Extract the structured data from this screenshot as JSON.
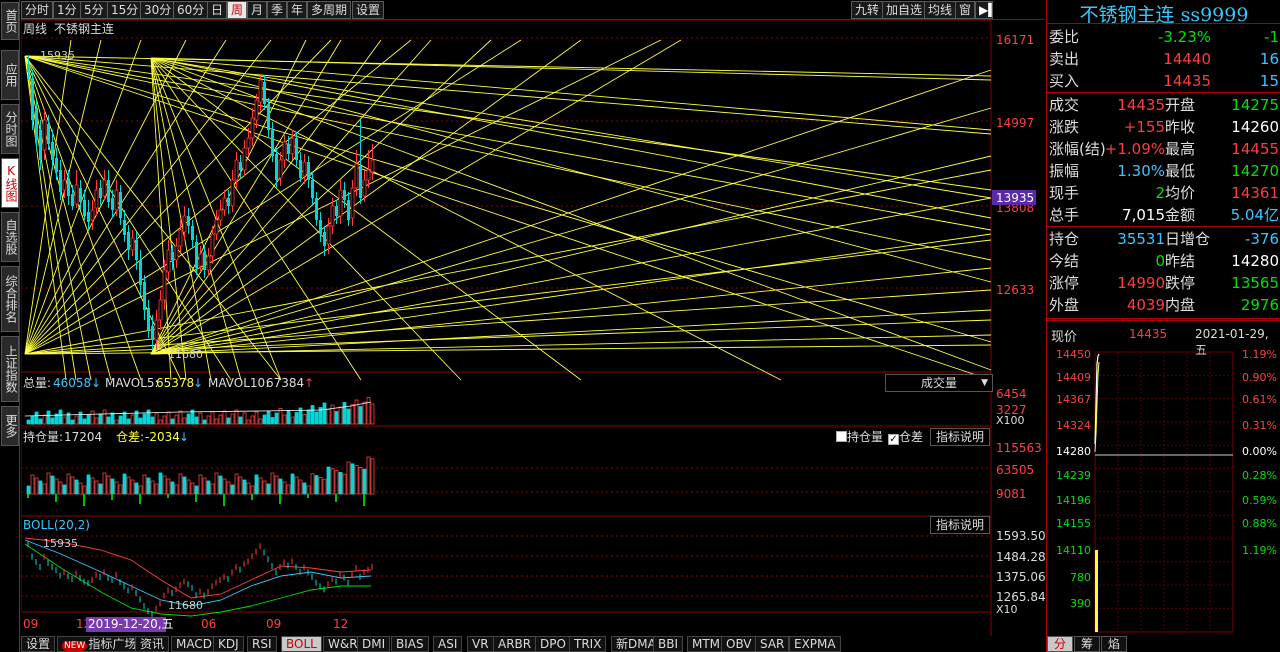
{
  "sidebar": {
    "items": [
      {
        "label": "首页",
        "active": false
      },
      {
        "label": "应用",
        "active": false
      },
      {
        "label": "分时图",
        "active": false
      },
      {
        "label": "K线图",
        "active": true
      },
      {
        "label": "自选股",
        "active": false
      },
      {
        "label": "综合排名",
        "active": false
      },
      {
        "label": "上证指数",
        "active": false
      },
      {
        "label": "更多",
        "active": false
      }
    ]
  },
  "periods": [
    "分时",
    "1分",
    "5分",
    "15分",
    "30分",
    "60分",
    "日",
    "周",
    "月",
    "季",
    "年",
    "多周期",
    "设置"
  ],
  "active_period": "周",
  "toolbar_right": [
    "九转",
    "加自选",
    "均线",
    "窗"
  ],
  "chart": {
    "period_label": "周线",
    "instrument": "不锈钢主连",
    "price_axis": [
      "16171",
      "14997",
      "13935",
      "13808",
      "12633"
    ],
    "current_price_tag": "13935",
    "high_label": "15935",
    "low_label": "11680",
    "volume": {
      "label": "总量:",
      "total": "46058",
      "mavol5_label": "MAVOL5:",
      "mavol5": "65378",
      "mavol10_label": "MAVOL10:",
      "mavol10": "67384",
      "dropdown": "成交量",
      "axis": [
        "6454",
        "3227",
        "X100"
      ]
    },
    "oi": {
      "label": "持仓量:",
      "value": "17204",
      "diff_label": "仓差:",
      "diff": "-2034",
      "cb1": "持仓量",
      "cb2": "仓差",
      "explain": "指标说明",
      "axis": [
        "115563",
        "63505",
        "9081"
      ]
    },
    "boll": {
      "label": "BOLL(20,2)",
      "explain": "指标说明",
      "high_label": "15935",
      "low_label": "11680",
      "axis": [
        "1593.50",
        "1484.28",
        "1375.06",
        "1265.84",
        "X10"
      ]
    },
    "x_axis": [
      "09",
      "12",
      "06",
      "09",
      "12"
    ],
    "cursor_date": "2019-12-20,五"
  },
  "bottom_tabs": [
    {
      "label": "设置"
    },
    {
      "label": "指标广场",
      "badge": "NEW"
    },
    {
      "label": "资讯"
    },
    {
      "label": "MACD"
    },
    {
      "label": "KDJ"
    },
    {
      "label": "RSI"
    },
    {
      "label": "BOLL",
      "active": true
    },
    {
      "label": "W&R"
    },
    {
      "label": "DMI"
    },
    {
      "label": "BIAS"
    },
    {
      "label": "ASI"
    },
    {
      "label": "VR"
    },
    {
      "label": "ARBR"
    },
    {
      "label": "DPO"
    },
    {
      "label": "TRIX"
    },
    {
      "label": "新DMA"
    },
    {
      "label": "BBI"
    },
    {
      "label": "MTM"
    },
    {
      "label": "OBV"
    },
    {
      "label": "SAR"
    },
    {
      "label": "EXPMA"
    }
  ],
  "quote": {
    "title": "不锈钢主连 ss9999",
    "rows": [
      {
        "l1": "委比",
        "v1": "-3.23%",
        "c1": "green",
        "v2": "-1",
        "c2": "green"
      },
      {
        "l1": "卖出",
        "v1": "14440",
        "c1": "red",
        "v2": "16",
        "c2": "cyan"
      },
      {
        "l1": "买入",
        "v1": "14435",
        "c1": "red",
        "v2": "15",
        "c2": "cyan"
      },
      {
        "l1": "成交",
        "v1": "14435",
        "c1": "red",
        "l2": "开盘",
        "v2": "14275",
        "c2": "green"
      },
      {
        "l1": "涨跌",
        "v1": "+155",
        "c1": "red",
        "l2": "昨收",
        "v2": "14260",
        "c2": "white"
      },
      {
        "l1": "涨幅(结)",
        "v1": "+1.09%",
        "c1": "red",
        "l2": "最高",
        "v2": "14455",
        "c2": "red"
      },
      {
        "l1": "振幅",
        "v1": "1.30%",
        "c1": "cyan",
        "l2": "最低",
        "v2": "14270",
        "c2": "green"
      },
      {
        "l1": "现手",
        "v1": "2",
        "c1": "green",
        "l2": "均价",
        "v2": "14361",
        "c2": "red"
      },
      {
        "l1": "总手",
        "v1": "7,015",
        "c1": "white",
        "l2": "金额",
        "v2": "5.04亿",
        "c2": "cyan"
      },
      {
        "l1": "持仓",
        "v1": "35531",
        "c1": "cyan",
        "l2": "日增仓",
        "v2": "-376",
        "c2": "cyan"
      },
      {
        "l1": "今结",
        "v1": "0",
        "c1": "green",
        "l2": "昨结",
        "v2": "14280",
        "c2": "white"
      },
      {
        "l1": "涨停",
        "v1": "14990",
        "c1": "red",
        "l2": "跌停",
        "v2": "13565",
        "c2": "green"
      },
      {
        "l1": "外盘",
        "v1": "4039",
        "c1": "red",
        "l2": "内盘",
        "v2": "2976",
        "c2": "green"
      }
    ],
    "now_label": "现价",
    "now_price": "14435",
    "date": "2021-01-29,五",
    "mini_left": [
      "14450",
      "14409",
      "14367",
      "14324",
      "14280",
      "14239",
      "14196",
      "14155",
      "14110",
      "780",
      "390"
    ],
    "mini_right": [
      "1.19%",
      "0.90%",
      "0.61%",
      "0.31%",
      "0.00%",
      "0.28%",
      "0.59%",
      "0.88%",
      "1.19%"
    ],
    "tabs": [
      "分",
      "筹",
      "焰"
    ]
  },
  "colors": {
    "up": "#ff3b3b",
    "down": "#00d8d8",
    "gann": "#ffff40",
    "accent": "#38c8ff",
    "frame": "#a00000"
  }
}
